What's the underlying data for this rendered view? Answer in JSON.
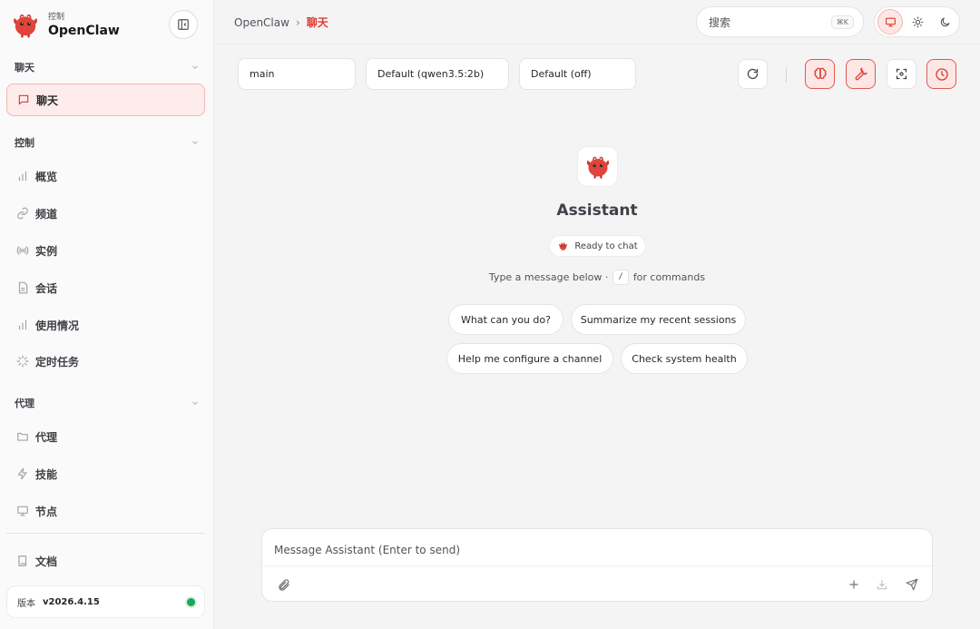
{
  "brand": {
    "subtitle": "控制",
    "name": "OpenClaw"
  },
  "sidebar": {
    "sections": [
      {
        "label": "聊天"
      },
      {
        "label": "控制"
      },
      {
        "label": "代理"
      }
    ],
    "items": [
      {
        "label": "聊天",
        "icon": "message-icon",
        "active": true
      },
      {
        "label": "概览",
        "icon": "bar-chart-icon"
      },
      {
        "label": "频道",
        "icon": "link-icon"
      },
      {
        "label": "实例",
        "icon": "broadcast-icon"
      },
      {
        "label": "会话",
        "icon": "document-icon"
      },
      {
        "label": "使用情况",
        "icon": "bar-chart-icon"
      },
      {
        "label": "定时任务",
        "icon": "loader-icon"
      },
      {
        "label": "代理",
        "icon": "folder-icon"
      },
      {
        "label": "技能",
        "icon": "zap-icon"
      },
      {
        "label": "节点",
        "icon": "monitor-icon"
      },
      {
        "label": "文档",
        "icon": "book-icon"
      }
    ],
    "version": {
      "label": "版本",
      "value": "v2026.4.15",
      "status_color": "#22a35a"
    }
  },
  "topbar": {
    "breadcrumb": {
      "root": "OpenClaw",
      "separator": "›",
      "current": "聊天"
    },
    "search": {
      "placeholder": "搜索",
      "shortcut": "⌘K"
    }
  },
  "toolbar": {
    "session": "main",
    "model": "Default (qwen3.5:2b)",
    "thinking": "Default (off)"
  },
  "welcome": {
    "title": "Assistant",
    "status": "Ready to chat",
    "hint_before": "Type a message below ·",
    "hint_key": "/",
    "hint_after": "for commands",
    "suggestions": [
      "What can you do?",
      "Summarize my recent sessions",
      "Help me configure a channel",
      "Check system health"
    ]
  },
  "composer": {
    "placeholder": "Message Assistant (Enter to send)"
  },
  "colors": {
    "accent": "#dc3b30",
    "accent_soft": "#fde7e5",
    "status_ok": "#22a35a"
  }
}
